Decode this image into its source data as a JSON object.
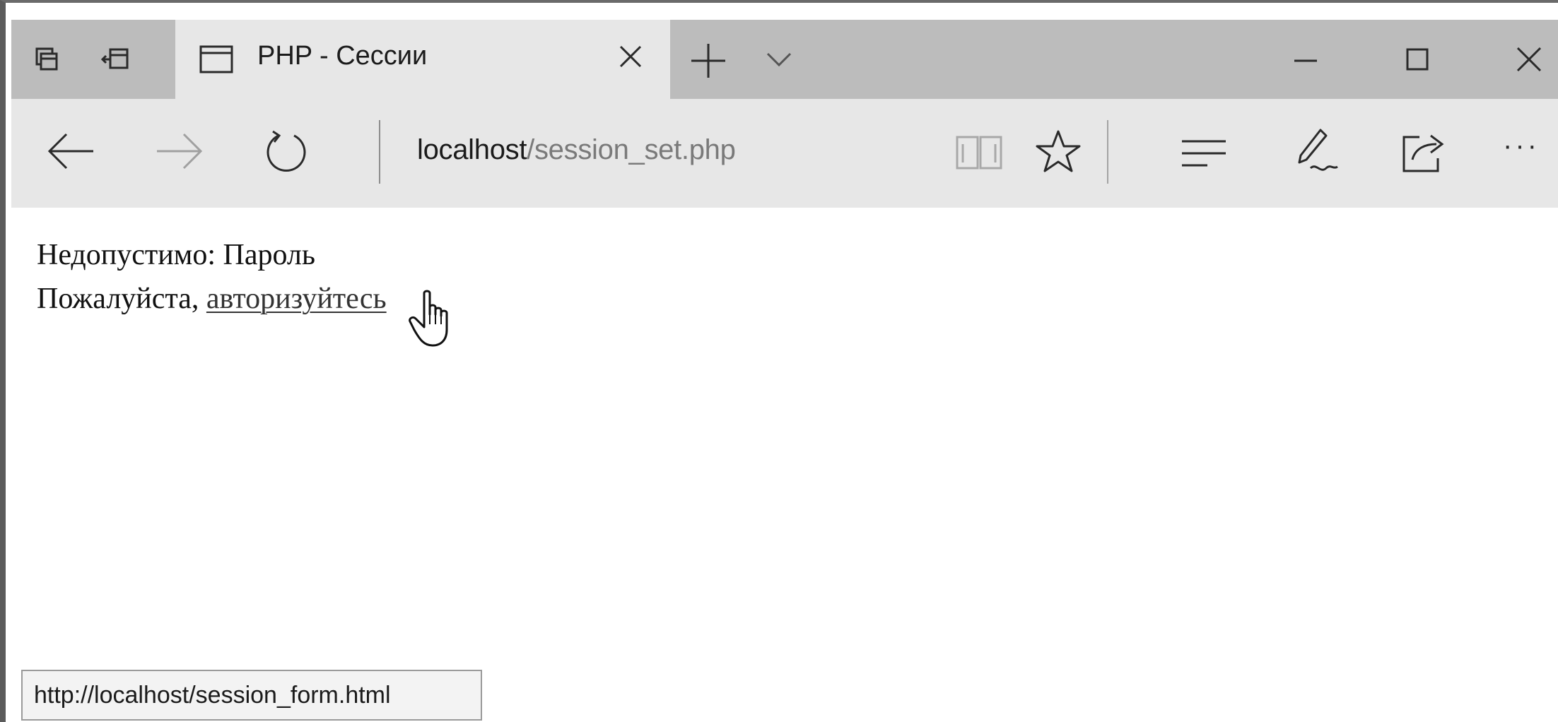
{
  "window": {
    "tab_title": "PHP - Сессии",
    "buttons": {
      "minimize": "–",
      "maximize": "☐",
      "close": "✕"
    }
  },
  "tab_bar": {
    "icons": [
      "tab-preview-icon",
      "set-aside-tabs-icon",
      "page-icon",
      "close-icon",
      "plus-icon",
      "chevron-down-icon"
    ]
  },
  "address_bar": {
    "url_host": "localhost",
    "url_path": "/session_set.php"
  },
  "toolbar": {
    "icons": [
      "back-arrow-icon",
      "forward-arrow-icon",
      "refresh-icon",
      "reading-view-icon",
      "star-icon",
      "hub-icon",
      "pen-icon",
      "share-icon",
      "more-icon"
    ],
    "more_label": "···"
  },
  "page": {
    "line1": "Недопустимо: Пароль",
    "line2_prefix": "Пожалуйста, ",
    "link_text": "авторизуйтесь"
  },
  "status_bar": {
    "link_url": "http://localhost/session_form.html"
  },
  "colors": {
    "titlebar": "#bcbcbc",
    "active_tab": "#e7e7e7",
    "toolbar": "#e7e7e7",
    "page_bg": "#ffffff",
    "text": "#111111"
  }
}
